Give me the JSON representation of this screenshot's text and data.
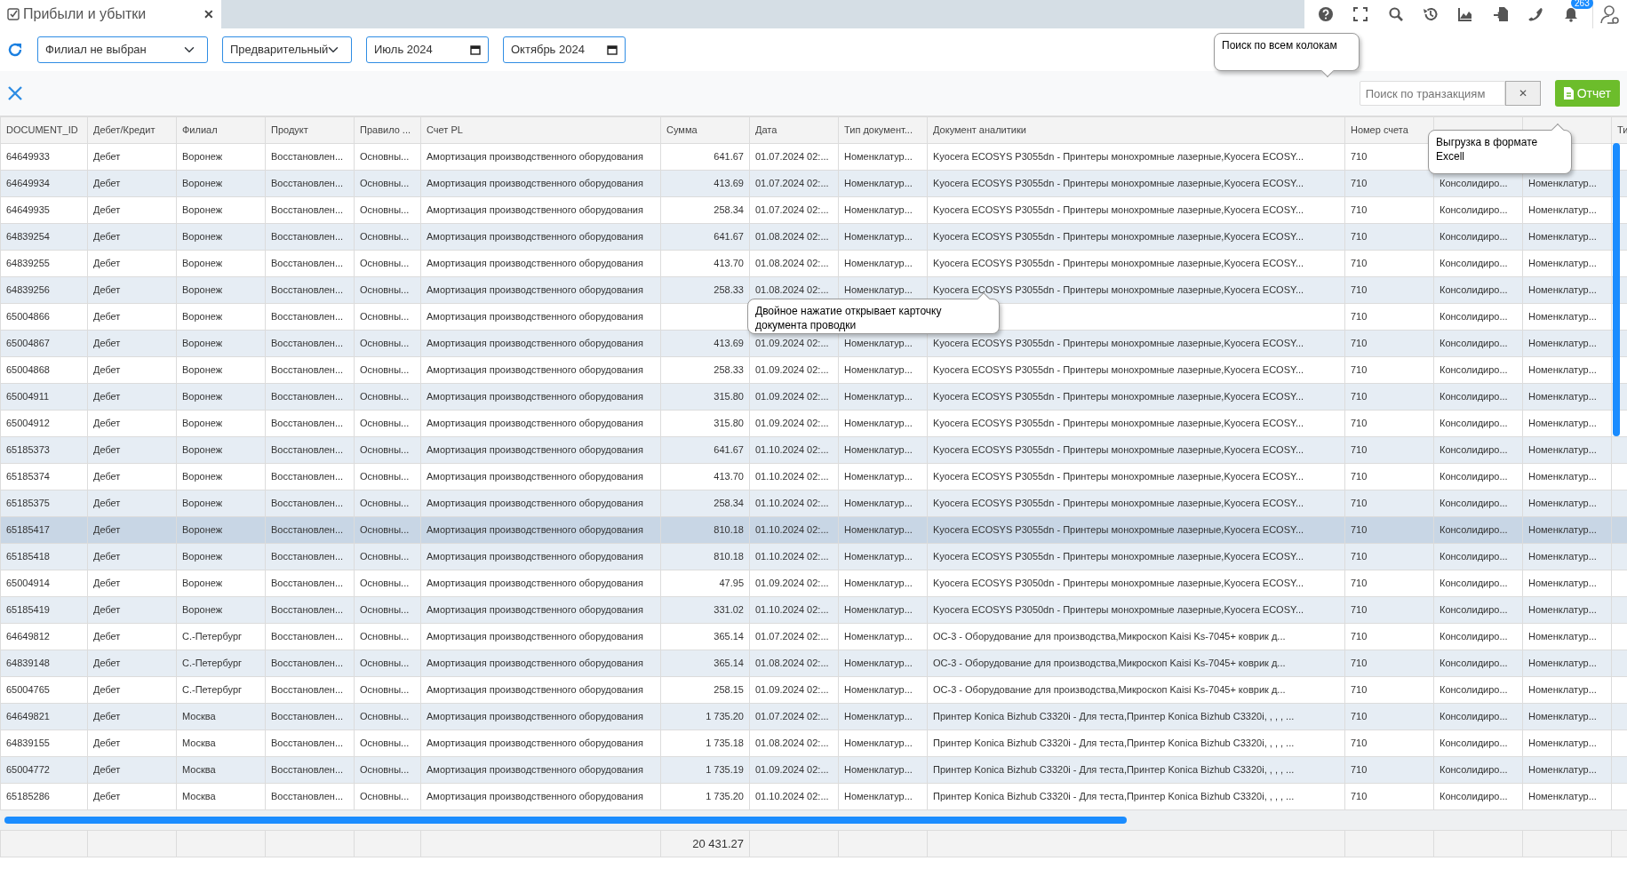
{
  "tab": {
    "title": "Прибыли и убытки",
    "close": "✕",
    "selected": true
  },
  "header_icons": {
    "badge": "263"
  },
  "filters": {
    "branch": "Филиал не выбран",
    "mode": "Предварительный",
    "date_from": "Июль 2024",
    "date_to": "Октябрь 2024"
  },
  "toolbar": {
    "search": {
      "placeholder": "Поиск по транзакциям"
    },
    "clear": "✕",
    "report": "Отчет"
  },
  "tooltips": [
    {
      "kind": "search",
      "text": "Поиск по всем колокам"
    },
    {
      "kind": "export",
      "text": "Выгрузка в формате Excell"
    },
    {
      "kind": "row",
      "text": "Двойное нажатие открывает карточку документа проводки"
    }
  ],
  "table": {
    "columns": [
      {
        "label": "DOCUMENT_ID",
        "kind": "text"
      },
      {
        "label": "Дебет/Кредит",
        "kind": "text"
      },
      {
        "label": "Филиал",
        "kind": "text"
      },
      {
        "label": "Продукт",
        "kind": "text"
      },
      {
        "label": "Правило ...",
        "kind": "text"
      },
      {
        "label": "Счет PL",
        "kind": "text"
      },
      {
        "label": "Сумма",
        "kind": "number"
      },
      {
        "label": "Дата",
        "kind": "text"
      },
      {
        "label": "Тип документ...",
        "kind": "text"
      },
      {
        "label": "Документ аналитики",
        "kind": "text"
      },
      {
        "label": "Номер счета",
        "kind": "text"
      },
      {
        "kind": "text"
      },
      {
        "kind": "text"
      },
      {
        "label": "Ти",
        "kind": "text"
      }
    ],
    "rows": [
      {
        "selected": false,
        "cells": [
          "64649933",
          "Дебет",
          "Воронеж",
          "Восстановлен...",
          "Основны...",
          "Амортизация производственного оборудования",
          "641.67",
          "01.07.2024 02:...",
          "Номенклатур...",
          "Kyocera ECOSYS P3055dn - Принтеры монохромные лазерные,Kyocera ECOSY...",
          "710",
          null,
          null
        ]
      },
      {
        "selected": false,
        "cells": [
          "64649934",
          "Дебет",
          "Воронеж",
          "Восстановлен...",
          "Основны...",
          "Амортизация производственного оборудования",
          "413.69",
          "01.07.2024 02:...",
          "Номенклатур...",
          "Kyocera ECOSYS P3055dn - Принтеры монохромные лазерные,Kyocera ECOSY...",
          "710",
          "Консолидиро...",
          "Номенклатур..."
        ]
      },
      {
        "selected": false,
        "cells": [
          "64649935",
          "Дебет",
          "Воронеж",
          "Восстановлен...",
          "Основны...",
          "Амортизация производственного оборудования",
          "258.34",
          "01.07.2024 02:...",
          "Номенклатур...",
          "Kyocera ECOSYS P3055dn - Принтеры монохромные лазерные,Kyocera ECOSY...",
          "710",
          "Консолидиро...",
          "Номенклатур..."
        ]
      },
      {
        "selected": false,
        "cells": [
          "64839254",
          "Дебет",
          "Воронеж",
          "Восстановлен...",
          "Основны...",
          "Амортизация производственного оборудования",
          "641.67",
          "01.08.2024 02:...",
          "Номенклатур...",
          "Kyocera ECOSYS P3055dn - Принтеры монохромные лазерные,Kyocera ECOSY...",
          "710",
          "Консолидиро...",
          "Номенклатур..."
        ]
      },
      {
        "selected": false,
        "cells": [
          "64839255",
          "Дебет",
          "Воронеж",
          "Восстановлен...",
          "Основны...",
          "Амортизация производственного оборудования",
          "413.70",
          "01.08.2024 02:...",
          "Номенклатур...",
          "Kyocera ECOSYS P3055dn - Принтеры монохромные лазерные,Kyocera ECOSY...",
          "710",
          "Консолидиро...",
          "Номенклатур..."
        ]
      },
      {
        "selected": false,
        "cells": [
          "64839256",
          "Дебет",
          "Воронеж",
          "Восстановлен...",
          "Основны...",
          "Амортизация производственного оборудования",
          "258.33",
          "01.08.2024 02:...",
          "Номенклатур...",
          "Kyocera ECOSYS P3055dn - Принтеры монохромные лазерные,Kyocera ECOSY...",
          "710",
          "Консолидиро...",
          "Номенклатур..."
        ]
      },
      {
        "selected": false,
        "cells": [
          "65004866",
          "Дебет",
          "Воронеж",
          "Восстановлен...",
          "Основны...",
          "Амортизация производственного оборудования",
          null,
          null,
          null,
          null,
          "710",
          "Консолидиро...",
          "Номенклатур..."
        ]
      },
      {
        "selected": false,
        "cells": [
          "65004867",
          "Дебет",
          "Воронеж",
          "Восстановлен...",
          "Основны...",
          "Амортизация производственного оборудования",
          "413.69",
          "01.09.2024 02:...",
          "Номенклатур...",
          "Kyocera ECOSYS P3055dn - Принтеры монохромные лазерные,Kyocera ECOSY...",
          "710",
          "Консолидиро...",
          "Номенклатур..."
        ]
      },
      {
        "selected": false,
        "cells": [
          "65004868",
          "Дебет",
          "Воронеж",
          "Восстановлен...",
          "Основны...",
          "Амортизация производственного оборудования",
          "258.33",
          "01.09.2024 02:...",
          "Номенклатур...",
          "Kyocera ECOSYS P3055dn - Принтеры монохромные лазерные,Kyocera ECOSY...",
          "710",
          "Консолидиро...",
          "Номенклатур..."
        ]
      },
      {
        "selected": false,
        "cells": [
          "65004911",
          "Дебет",
          "Воронеж",
          "Восстановлен...",
          "Основны...",
          "Амортизация производственного оборудования",
          "315.80",
          "01.09.2024 02:...",
          "Номенклатур...",
          "Kyocera ECOSYS P3055dn - Принтеры монохромные лазерные,Kyocera ECOSY...",
          "710",
          "Консолидиро...",
          "Номенклатур..."
        ]
      },
      {
        "selected": false,
        "cells": [
          "65004912",
          "Дебет",
          "Воронеж",
          "Восстановлен...",
          "Основны...",
          "Амортизация производственного оборудования",
          "315.80",
          "01.09.2024 02:...",
          "Номенклатур...",
          "Kyocera ECOSYS P3055dn - Принтеры монохромные лазерные,Kyocera ECOSY...",
          "710",
          "Консолидиро...",
          "Номенклатур..."
        ]
      },
      {
        "selected": false,
        "cells": [
          "65185373",
          "Дебет",
          "Воронеж",
          "Восстановлен...",
          "Основны...",
          "Амортизация производственного оборудования",
          "641.67",
          "01.10.2024 02:...",
          "Номенклатур...",
          "Kyocera ECOSYS P3055dn - Принтеры монохромные лазерные,Kyocera ECOSY...",
          "710",
          "Консолидиро...",
          "Номенклатур..."
        ]
      },
      {
        "selected": false,
        "cells": [
          "65185374",
          "Дебет",
          "Воронеж",
          "Восстановлен...",
          "Основны...",
          "Амортизация производственного оборудования",
          "413.70",
          "01.10.2024 02:...",
          "Номенклатур...",
          "Kyocera ECOSYS P3055dn - Принтеры монохромные лазерные,Kyocera ECOSY...",
          "710",
          "Консолидиро...",
          "Номенклатур..."
        ]
      },
      {
        "selected": false,
        "cells": [
          "65185375",
          "Дебет",
          "Воронеж",
          "Восстановлен...",
          "Основны...",
          "Амортизация производственного оборудования",
          "258.34",
          "01.10.2024 02:...",
          "Номенклатур...",
          "Kyocera ECOSYS P3055dn - Принтеры монохромные лазерные,Kyocera ECOSY...",
          "710",
          "Консолидиро...",
          "Номенклатур..."
        ]
      },
      {
        "selected": true,
        "cells": [
          "65185417",
          "Дебет",
          "Воронеж",
          "Восстановлен...",
          "Основны...",
          "Амортизация производственного оборудования",
          "810.18",
          "01.10.2024 02:...",
          "Номенклатур...",
          "Kyocera ECOSYS P3055dn - Принтеры монохромные лазерные,Kyocera ECOSY...",
          "710",
          "Консолидиро...",
          "Номенклатур..."
        ]
      },
      {
        "selected": false,
        "cells": [
          "65185418",
          "Дебет",
          "Воронеж",
          "Восстановлен...",
          "Основны...",
          "Амортизация производственного оборудования",
          "810.18",
          "01.10.2024 02:...",
          "Номенклатур...",
          "Kyocera ECOSYS P3055dn - Принтеры монохромные лазерные,Kyocera ECOSY...",
          "710",
          "Консолидиро...",
          "Номенклатур..."
        ]
      },
      {
        "selected": false,
        "cells": [
          "65004914",
          "Дебет",
          "Воронеж",
          "Восстановлен...",
          "Основны...",
          "Амортизация производственного оборудования",
          "47.95",
          "01.09.2024 02:...",
          "Номенклатур...",
          "Kyocera ECOSYS P3050dn - Принтеры монохромные лазерные,Kyocera ECOSY...",
          "710",
          "Консолидиро...",
          "Номенклатур..."
        ]
      },
      {
        "selected": false,
        "cells": [
          "65185419",
          "Дебет",
          "Воронеж",
          "Восстановлен...",
          "Основны...",
          "Амортизация производственного оборудования",
          "331.02",
          "01.10.2024 02:...",
          "Номенклатур...",
          "Kyocera ECOSYS P3050dn - Принтеры монохромные лазерные,Kyocera ECOSY...",
          "710",
          "Консолидиро...",
          "Номенклатур..."
        ]
      },
      {
        "selected": false,
        "cells": [
          "64649812",
          "Дебет",
          "С.-Петербург",
          "Восстановлен...",
          "Основны...",
          "Амортизация производственного оборудования",
          "365.14",
          "01.07.2024 02:...",
          "Номенклатур...",
          "ОС-3 - Оборудование для производства,Микроскоп Kaisi Ks-7045+ коврик д...",
          "710",
          "Консолидиро...",
          "Номенклатур..."
        ]
      },
      {
        "selected": false,
        "cells": [
          "64839148",
          "Дебет",
          "С.-Петербург",
          "Восстановлен...",
          "Основны...",
          "Амортизация производственного оборудования",
          "365.14",
          "01.08.2024 02:...",
          "Номенклатур...",
          "ОС-3 - Оборудование для производства,Микроскоп Kaisi Ks-7045+ коврик д...",
          "710",
          "Консолидиро...",
          "Номенклатур..."
        ]
      },
      {
        "selected": false,
        "cells": [
          "65004765",
          "Дебет",
          "С.-Петербург",
          "Восстановлен...",
          "Основны...",
          "Амортизация производственного оборудования",
          "258.15",
          "01.09.2024 02:...",
          "Номенклатур...",
          "ОС-3 - Оборудование для производства,Микроскоп Kaisi Ks-7045+ коврик д...",
          "710",
          "Консолидиро...",
          "Номенклатур..."
        ]
      },
      {
        "selected": false,
        "cells": [
          "64649821",
          "Дебет",
          "Москва",
          "Восстановлен...",
          "Основны...",
          "Амортизация производственного оборудования",
          "1 735.20",
          "01.07.2024 02:...",
          "Номенклатур...",
          "Принтер Konica Bizhub C3320i - Для теста,Принтер Konica Bizhub C3320i, , , , ...",
          "710",
          "Консолидиро...",
          "Номенклатур..."
        ]
      },
      {
        "selected": false,
        "cells": [
          "64839155",
          "Дебет",
          "Москва",
          "Восстановлен...",
          "Основны...",
          "Амортизация производственного оборудования",
          "1 735.18",
          "01.08.2024 02:...",
          "Номенклатур...",
          "Принтер Konica Bizhub C3320i - Для теста,Принтер Konica Bizhub C3320i, , , , ...",
          "710",
          "Консолидиро...",
          "Номенклатур..."
        ]
      },
      {
        "selected": false,
        "cells": [
          "65004772",
          "Дебет",
          "Москва",
          "Восстановлен...",
          "Основны...",
          "Амортизация производственного оборудования",
          "1 735.19",
          "01.09.2024 02:...",
          "Номенклатур...",
          "Принтер Konica Bizhub C3320i - Для теста,Принтер Konica Bizhub C3320i, , , , ...",
          "710",
          "Консолидиро...",
          "Номенклатур..."
        ]
      },
      {
        "selected": false,
        "cells": [
          "65185286",
          "Дебет",
          "Москва",
          "Восстановлен...",
          "Основны...",
          "Амортизация производственного оборудования",
          "1 735.20",
          "01.10.2024 02:...",
          "Номенклатур...",
          "Принтер Konica Bizhub C3320i - Для теста,Принтер Konica Bizhub C3320i, , , , ...",
          "710",
          "Консолидиро...",
          "Номенклатур..."
        ]
      }
    ],
    "total": "20 431.27"
  }
}
